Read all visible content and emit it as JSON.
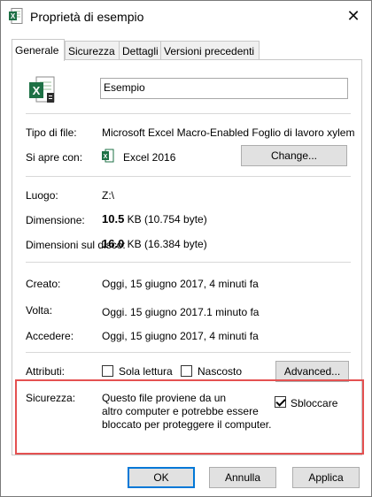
{
  "window": {
    "title": "Proprietà di esempio",
    "close_glyph": "✕"
  },
  "tabs": [
    "Generale",
    "Sicurezza",
    "Dettagli",
    "Versioni precedenti"
  ],
  "general": {
    "file_name": "Esempio",
    "type_label": "Tipo di file:",
    "type_value": "Microsoft Excel Macro-Enabled Foglio di lavoro xylem",
    "opens_label": "Si apre con:",
    "opens_value": "Excel 2016",
    "change_button": "Change...",
    "location_label": "Luogo:",
    "location_value": "Z:\\",
    "size_label": "Dimensione:",
    "size_value_big": "10.5",
    "size_value_rest": " KB (10.754 byte)",
    "size_on_disk_label": "Dimensioni sul disco:",
    "size_on_disk_value_big": "16.0",
    "size_on_disk_value_rest": " KB (16.384 byte)",
    "created_label": "Creato:",
    "created_value": "Oggi, 15 giugno 2017, 4 minuti fa",
    "modified_label": "Volta:",
    "modified_value": "Oggi. 15 giugno 2017.1 minuto fa",
    "accessed_label": "Accedere:",
    "accessed_value": "Oggi, 15 giugno 2017, 4 minuti fa",
    "attributes_label": "Attributi:",
    "readonly_label": "Sola lettura",
    "hidden_label": "Nascosto",
    "advanced_button": "Advanced...",
    "security_label": "Sicurezza:",
    "security_line1": "Questo file proviene da un",
    "security_line2": "altro computer e potrebbe essere",
    "security_line3": "bloccato per proteggere il computer.",
    "unblock_label": "Sbloccare"
  },
  "footer": {
    "ok": "OK",
    "cancel": "Annulla",
    "apply": "Applica"
  },
  "colors": {
    "excel_green": "#1e7145",
    "highlight_red": "#e45151",
    "default_button_border": "#0078d7"
  }
}
